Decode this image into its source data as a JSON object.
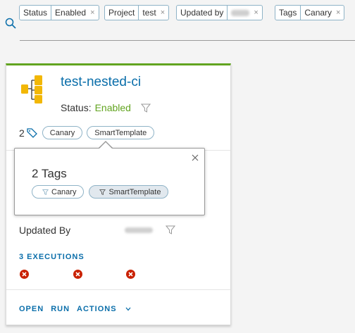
{
  "filters": [
    {
      "key": "Status",
      "value": "Enabled"
    },
    {
      "key": "Project",
      "value": "test"
    },
    {
      "key": "Updated by",
      "value": ""
    },
    {
      "key": "Tags",
      "value": "Canary"
    }
  ],
  "close_glyph": "×",
  "card": {
    "title": "test-nested-ci",
    "status_label": "Status:",
    "status_value": "Enabled",
    "tag_count": "2",
    "tags": [
      "Canary",
      "SmartTemplate"
    ],
    "updated_by_label": "Updated By",
    "executions_link": "3 EXECUTIONS",
    "execution_count": 3,
    "actions": {
      "open": "OPEN",
      "run": "RUN",
      "actions": "ACTIONS"
    },
    "status_color": "#62a420",
    "failed_color": "#c92100"
  },
  "popover": {
    "title": "2 Tags",
    "tags": [
      {
        "label": "Canary",
        "selected": false
      },
      {
        "label": "SmartTemplate",
        "selected": true
      }
    ]
  },
  "colors": {
    "accent": "#0a6eaa",
    "card_border_top": "#62a420"
  }
}
